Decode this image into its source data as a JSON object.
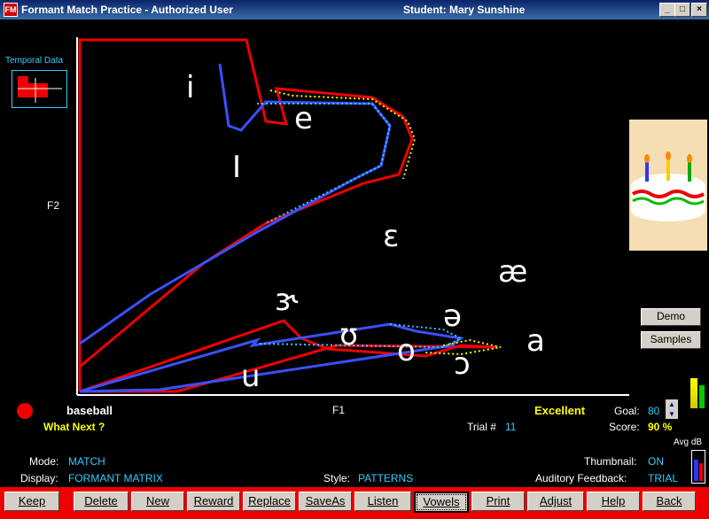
{
  "window": {
    "title": "Formant Match Practice - Authorized User",
    "student": "Student:  Mary Sunshine",
    "app_icon": "FM"
  },
  "window_buttons": {
    "minimize": "_",
    "maximize": "□",
    "close": "×"
  },
  "temporal": {
    "title": "Temporal Data"
  },
  "axes": {
    "y_label": "F2",
    "x_label": "F1"
  },
  "vowels": [
    "i",
    "e",
    "I",
    "ɛ",
    "æ",
    "ɝ",
    "ə",
    "ʊ",
    "o",
    "a",
    "u",
    "ɔ"
  ],
  "status": {
    "word": "baseball",
    "what_next": "What Next ?",
    "rating": "Excellent",
    "goal_label": "Goal:",
    "goal_value": "80",
    "trial_label": "Trial #",
    "trial_value": "11",
    "score_label": "Score:",
    "score_value": "90 %",
    "avg_db": "Avg dB"
  },
  "settings": {
    "mode_label": "Mode:",
    "mode_value": "MATCH",
    "display_label": "Display:",
    "display_value": "FORMANT MATRIX",
    "style_label": "Style:",
    "style_value": "PATTERNS",
    "thumbnail_label": "Thumbnail:",
    "thumbnail_value": "ON",
    "feedback_label": "Auditory  Feedback:",
    "feedback_value": "TRIAL"
  },
  "side_buttons": {
    "demo": "Demo",
    "samples": "Samples"
  },
  "toolbar": [
    "Keep",
    "Delete",
    "New",
    "Reward",
    "Replace",
    "SaveAs",
    "Listen",
    "Vowels",
    "Print",
    "Adjust",
    "Help",
    "Back"
  ],
  "colors": {
    "target_trace": "#e00000",
    "attempt_trace": "#3a50ff",
    "cyan_dots": "#33ccff",
    "yellow_dots": "#ffee00",
    "toolbar": "#ee0000"
  }
}
